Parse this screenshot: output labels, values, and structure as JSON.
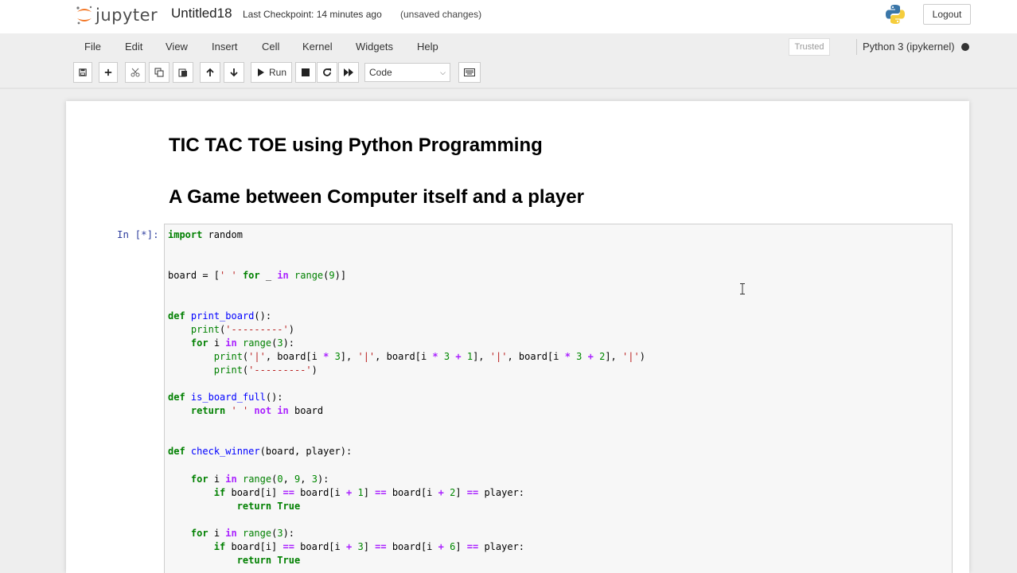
{
  "header": {
    "logo_text": "jupyter",
    "notebook_name": "Untitled18",
    "checkpoint": "Last Checkpoint: 14 minutes ago",
    "unsaved": "(unsaved changes)",
    "logout_label": "Logout"
  },
  "menu": {
    "items": [
      "File",
      "Edit",
      "View",
      "Insert",
      "Cell",
      "Kernel",
      "Widgets",
      "Help"
    ],
    "trusted": "Trusted",
    "kernel": "Python 3 (ipykernel)"
  },
  "toolbar": {
    "run_label": "Run",
    "cell_type": "Code",
    "icons": [
      "save-icon",
      "plus-icon",
      "cut-icon",
      "copy-icon",
      "paste-icon",
      "arrow-up-icon",
      "arrow-down-icon",
      "play-icon",
      "stop-icon",
      "restart-icon",
      "fast-forward-icon",
      "keyboard-icon"
    ]
  },
  "markdown": {
    "h1": "TIC TAC TOE using Python Programming",
    "h2": "A Game between Computer itself and a player"
  },
  "cell": {
    "prompt": "In [*]:"
  },
  "colors": {
    "keyword": "#008000",
    "string": "#ba2121",
    "prompt": "#303f9f",
    "logo_orange": "#f37726"
  }
}
